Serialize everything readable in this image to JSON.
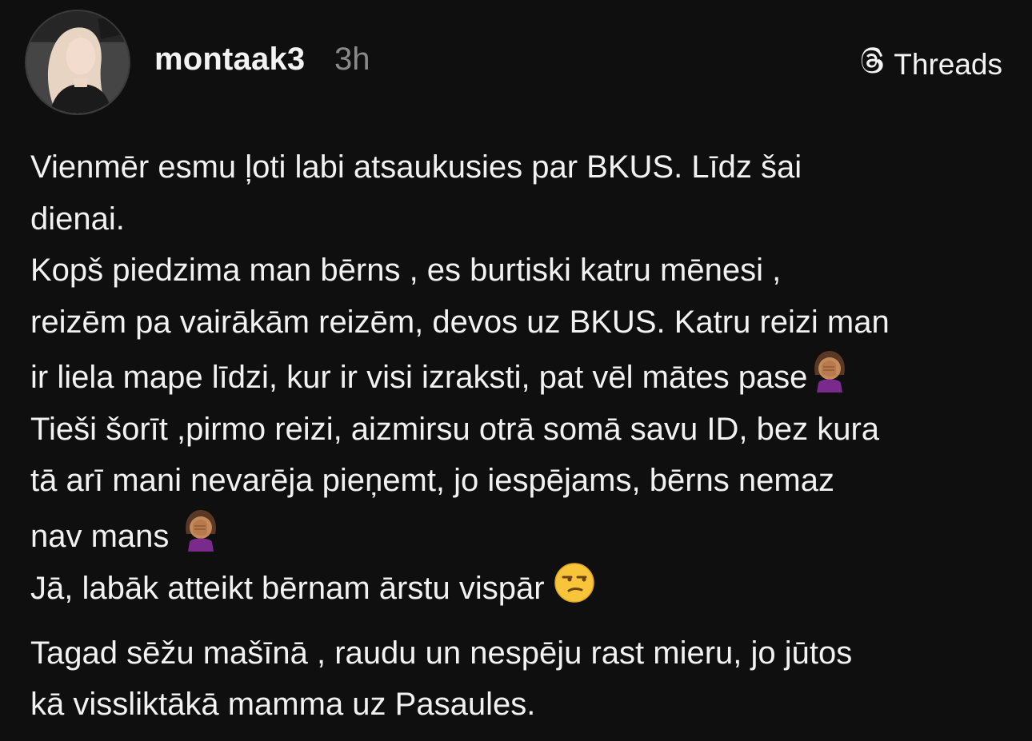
{
  "post": {
    "username": "montaak3",
    "time": "3h",
    "brand_label": "Threads",
    "line_1": "Vienmēr esmu ļoti labi atsaukusies par BKUS. Līdz šai",
    "line_2": "dienai.",
    "line_3": "Kopš piedzima man bērns , es burtiski katru mēnesi ,",
    "line_4": "reizēm pa vairākām reizēm, devos uz BKUS. Katru reizi man",
    "line_5": "ir liela mape līdzi, kur ir visi izraksti, pat vēl mātes pase",
    "line_6": "Tieši šorīt ,pirmo reizi, aizmirsu otrā somā savu ID, bez kura",
    "line_7": "tā arī mani nevarēja pieņemt, jo iespējams, bērns nemaz",
    "line_8": "nav mans ",
    "line_9": "Jā, labāk atteikt bērnam ārstu vispār ",
    "line_10": "Tagad sēžu mašīnā , raudu un nespēju rast mieru, jo jūtos",
    "line_11": "kā vissliktākā mamma uz Pasaules."
  },
  "icons": {
    "avatar": "profile-photo",
    "brand": "threads-logo-icon",
    "emoji_1": "face-palm-woman-emoji",
    "emoji_2": "face-palm-woman-emoji",
    "emoji_3": "unamused-face-emoji"
  },
  "colors": {
    "background": "#0f0f0f",
    "text": "#f2f2f2",
    "muted": "#8a8a8a"
  }
}
